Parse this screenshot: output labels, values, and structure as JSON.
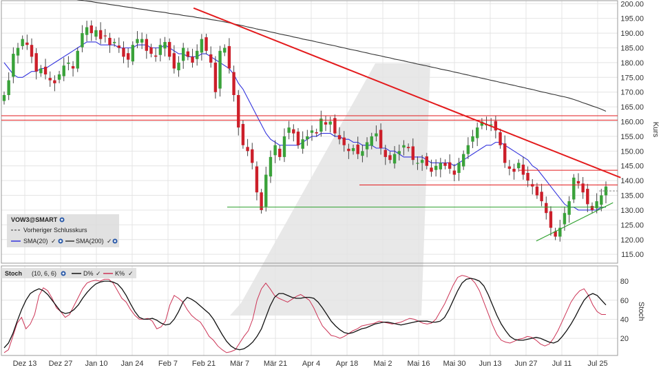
{
  "colors": {
    "up": "#3aa23a",
    "down": "#cc1f2a",
    "sma20": "#3333dd",
    "sma200": "#333333",
    "stoch_d": "#111111",
    "stoch_k": "#cc3355",
    "grid": "#e4e4e4",
    "prev_close": "#888888",
    "trend_red": "#e31a1c",
    "support_green": "#2ca02c",
    "legend_bg": "#dcdcdc",
    "watermark": "#d6d6d6"
  },
  "price_legend": {
    "symbol": "VOW3@SMART",
    "prev_close_label": "Vorheriger Schlusskurs",
    "sma20_label": "SMA(20)",
    "sma200_label": "SMA(200)",
    "icon": "globe-icon"
  },
  "stoch_legend": {
    "title": "Stoch",
    "params": "(10, 6, 6)",
    "d_label": "D%",
    "k_label": "K%",
    "icon": "globe-icon"
  },
  "chart_data": [
    {
      "type": "candlestick",
      "title": "",
      "ylabel": "Kurs",
      "ylim": [
        112,
        201
      ],
      "yticks": [
        "115.00",
        "120.00",
        "125.00",
        "130.00",
        "135.00",
        "140.00",
        "145.00",
        "150.00",
        "155.00",
        "160.00",
        "165.00",
        "170.00",
        "175.00",
        "180.00",
        "185.00",
        "190.00",
        "195.00",
        "200.00"
      ],
      "xticks": [
        "Dez 13",
        "Dez 27",
        "Jan 10",
        "Jan 24",
        "Feb 7",
        "Feb 21",
        "Mär 7",
        "Mär 21",
        "Apr 4",
        "Apr 18",
        "Mai 2",
        "Mai 16",
        "Mai 30",
        "Jun 13",
        "Jun 27",
        "Jul 11",
        "Jul 25"
      ],
      "grid": true,
      "legend_position": "bottom-left",
      "close": [
        169,
        174,
        183,
        185,
        188,
        186,
        182,
        177,
        178,
        176,
        174,
        173,
        176,
        179,
        180,
        178,
        184,
        190,
        192,
        190,
        191,
        188,
        189,
        186,
        187,
        185,
        182,
        181,
        186,
        188,
        188,
        184,
        183,
        182,
        186,
        187,
        182,
        178,
        180,
        185,
        182,
        180,
        184,
        188,
        184,
        180,
        170,
        184,
        185,
        178,
        169,
        158,
        152,
        150,
        146,
        136,
        130,
        142,
        148,
        152,
        148,
        155,
        158,
        156,
        152,
        154,
        155,
        157,
        156,
        161,
        159,
        160,
        156,
        154,
        152,
        150,
        151,
        149,
        150,
        153,
        155,
        156,
        151,
        148,
        147,
        149,
        150,
        152,
        151,
        147,
        146,
        147,
        145,
        143,
        145,
        146,
        145,
        144,
        142,
        146,
        149,
        152,
        155,
        158,
        160,
        159,
        159,
        157,
        152,
        146,
        144,
        143,
        146,
        142,
        140,
        138,
        135,
        133,
        129,
        124,
        121,
        124,
        129,
        133,
        141,
        139,
        136,
        132,
        130,
        133,
        135,
        138
      ],
      "series": [
        {
          "name": "SMA(20)",
          "values": [
            180,
            178,
            176,
            175,
            175,
            176,
            177,
            177,
            178,
            178,
            179,
            180,
            181,
            182,
            183,
            184,
            185,
            186,
            187,
            187,
            187,
            186,
            186,
            186,
            186,
            185,
            185,
            185,
            185,
            186,
            186,
            186,
            185,
            185,
            185,
            186,
            185,
            184,
            183,
            183,
            182,
            182,
            182,
            183,
            183,
            182,
            181,
            180,
            179,
            178,
            176,
            173,
            171,
            168,
            165,
            162,
            159,
            156,
            154,
            153,
            152,
            152,
            152,
            152,
            152,
            153,
            154,
            155,
            155,
            156,
            156,
            156,
            155,
            155,
            154,
            154,
            153,
            153,
            152,
            152,
            152,
            151,
            151,
            151,
            150,
            150,
            149,
            148,
            148,
            148,
            148,
            148,
            147,
            146,
            146,
            146,
            146,
            146,
            145,
            146,
            147,
            148,
            149,
            150,
            151,
            152,
            152,
            153,
            153,
            152,
            151,
            150,
            149,
            148,
            147,
            145,
            144,
            142,
            140,
            138,
            136,
            134,
            132,
            131,
            131,
            130,
            130,
            130,
            130,
            130,
            131,
            131
          ]
        },
        {
          "name": "SMA(200)",
          "values": [
            205,
            204.8,
            204.6,
            204.4,
            204.1,
            203.9,
            203.7,
            203.4,
            203.2,
            203,
            202.7,
            202.5,
            202.3,
            202,
            201.8,
            201.6,
            201.3,
            201.1,
            200.9,
            200.7,
            200.4,
            200.2,
            200,
            199.7,
            199.5,
            199.3,
            199,
            198.8,
            198.6,
            198.3,
            198.1,
            197.9,
            197.6,
            197.4,
            197.2,
            197,
            196.7,
            196.5,
            196.3,
            196,
            195.8,
            195.6,
            195.3,
            195.1,
            194.9,
            194.6,
            194.4,
            194.1,
            193.8,
            193.5,
            193.1,
            192.8,
            192.5,
            192.1,
            191.8,
            191.4,
            191.1,
            190.8,
            190.4,
            190.1,
            189.7,
            189.4,
            189.1,
            188.7,
            188.4,
            188,
            187.7,
            187.4,
            187,
            186.7,
            186.3,
            186,
            185.7,
            185.3,
            185,
            184.6,
            184.3,
            184,
            183.6,
            183.3,
            182.9,
            182.6,
            182.3,
            181.9,
            181.6,
            181.2,
            180.9,
            180.6,
            180.2,
            179.9,
            179.5,
            179.2,
            178.9,
            178.5,
            178.2,
            177.8,
            177.5,
            177.2,
            176.8,
            176.5,
            176.1,
            175.8,
            175.4,
            175.1,
            174.7,
            174.4,
            174,
            173.7,
            173.3,
            173,
            172.6,
            172.3,
            171.9,
            171.6,
            171.2,
            170.9,
            170.5,
            170.1,
            169.8,
            169.4,
            169.1,
            168.7,
            168.4,
            168,
            167.5,
            167,
            166.4,
            165.9,
            165.3,
            164.8,
            164.2,
            163.5
          ]
        }
      ],
      "annotations": [
        {
          "type": "trendline",
          "color": "red",
          "from": {
            "x": "Feb 17",
            "y": 198.5
          },
          "to": {
            "x": "Aug 3",
            "y": 141
          }
        },
        {
          "type": "horizontal",
          "color": "red",
          "y": 162
        },
        {
          "type": "horizontal",
          "color": "red",
          "y": 160.5
        },
        {
          "type": "horizontal",
          "color": "red",
          "y": 143.5
        },
        {
          "type": "horizontal",
          "color": "red",
          "y": 138.5
        },
        {
          "type": "horizontal",
          "color": "green",
          "y": 131
        },
        {
          "type": "trendline",
          "color": "green",
          "from": {
            "x": "Jul 1",
            "y": 119.5
          },
          "to": {
            "x": "Jul 31",
            "y": 132.5
          }
        },
        {
          "type": "horizontal",
          "color": "gray-dashed",
          "y": 136.5
        }
      ]
    },
    {
      "type": "line",
      "title": "Stoch (10, 6, 6)",
      "ylabel": "Stoch",
      "ylim": [
        2,
        96
      ],
      "yticks": [
        "20",
        "40",
        "60",
        "80"
      ],
      "grid": true,
      "series": [
        {
          "name": "D%",
          "values": [
            10,
            15,
            25,
            38,
            50,
            60,
            67,
            70,
            72,
            70,
            66,
            60,
            54,
            48,
            46,
            47,
            50,
            55,
            62,
            68,
            73,
            77,
            79,
            80,
            80,
            79,
            77,
            72,
            65,
            56,
            48,
            42,
            40,
            40,
            41,
            39,
            36,
            34,
            35,
            40,
            48,
            58,
            63,
            61,
            58,
            54,
            50,
            46,
            40,
            32,
            24,
            17,
            12,
            9,
            8,
            9,
            12,
            16,
            22,
            30,
            42,
            54,
            63,
            67,
            67,
            65,
            63,
            62,
            62,
            63,
            63,
            62,
            58,
            52,
            45,
            38,
            33,
            29,
            26,
            25,
            26,
            28,
            30,
            31,
            33,
            35,
            36,
            37,
            37,
            36,
            35,
            34,
            35,
            36,
            37,
            38,
            38,
            38,
            37,
            37,
            38,
            42,
            50,
            60,
            70,
            78,
            82,
            83,
            82,
            80,
            75,
            66,
            55,
            44,
            35,
            28,
            22,
            19,
            18,
            18,
            19,
            20,
            21,
            20,
            18,
            16,
            15,
            17,
            22,
            28,
            35,
            43,
            52,
            60,
            65,
            67,
            65,
            60,
            55
          ]
        },
        {
          "name": "K%",
          "values": [
            5,
            8,
            22,
            36,
            42,
            30,
            35,
            45,
            65,
            73,
            70,
            62,
            52,
            48,
            42,
            45,
            54,
            63,
            72,
            78,
            80,
            81,
            80,
            82,
            82,
            78,
            70,
            62,
            58,
            50,
            44,
            40,
            40,
            41,
            38,
            30,
            32,
            38,
            55,
            65,
            62,
            58,
            50,
            44,
            40,
            37,
            30,
            22,
            18,
            12,
            8,
            5,
            6,
            8,
            15,
            22,
            28,
            40,
            60,
            72,
            78,
            72,
            65,
            62,
            60,
            58,
            61,
            64,
            66,
            63,
            60,
            52,
            42,
            33,
            28,
            23,
            22,
            20,
            22,
            25,
            28,
            30,
            33,
            34,
            35,
            36,
            38,
            37,
            36,
            35,
            36,
            37,
            39,
            41,
            40,
            38,
            36,
            35,
            36,
            40,
            48,
            56,
            66,
            76,
            84,
            86,
            85,
            83,
            78,
            70,
            58,
            46,
            34,
            24,
            18,
            16,
            15,
            17,
            19,
            20,
            22,
            21,
            18,
            14,
            12,
            14,
            20,
            28,
            38,
            48,
            58,
            65,
            70,
            72,
            65,
            55,
            48,
            45,
            45
          ]
        }
      ]
    }
  ]
}
